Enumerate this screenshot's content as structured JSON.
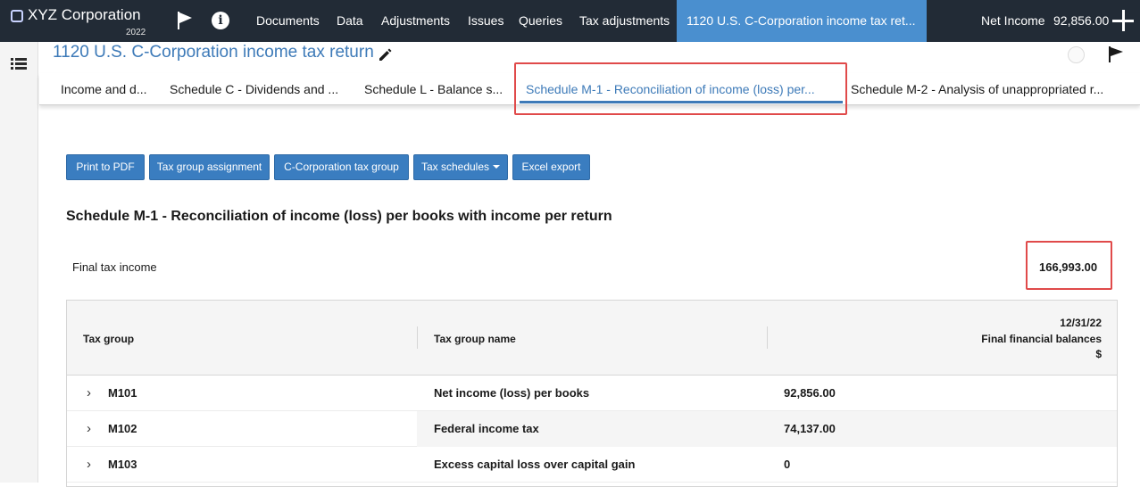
{
  "app": {
    "company": "XYZ Corporation",
    "year": "2022"
  },
  "topnav": {
    "items": [
      "Documents",
      "Data",
      "Adjustments",
      "Issues",
      "Queries",
      "Tax adjustments"
    ],
    "active": "1120 U.S. C-Corporation income tax ret...",
    "net_income_label": "Net Income",
    "net_income_value": "92,856.00"
  },
  "page": {
    "title": "1120 U.S. C-Corporation income tax return"
  },
  "tabs": [
    "Income and d...",
    "Schedule C - Dividends and ...",
    "Schedule L - Balance s...",
    "Schedule M-1 - Reconciliation of income (loss) per...",
    "Schedule M-2 - Analysis of unappropriated r..."
  ],
  "toolbar": {
    "print": "Print to PDF",
    "assignment": "Tax group assignment",
    "ccorp": "C-Corporation tax group",
    "schedules": "Tax schedules",
    "export": "Excel export"
  },
  "schedule": {
    "heading": "Schedule M-1 - Reconciliation of income (loss) per books with income per return",
    "final_label": "Final tax income",
    "final_value": "166,993.00"
  },
  "table": {
    "headers": {
      "group": "Tax group",
      "name": "Tax group name",
      "date": "12/31/22",
      "balances": "Final financial balances",
      "currency": "$"
    },
    "rows": [
      {
        "group": "M101",
        "name": "Net income (loss) per books",
        "value": "92,856.00"
      },
      {
        "group": "M102",
        "name": "Federal income tax",
        "value": "74,137.00"
      },
      {
        "group": "M103",
        "name": "Excess capital loss over capital gain",
        "value": "0"
      }
    ]
  },
  "colors": {
    "topbar": "#222b36",
    "accent": "#3d7ab8",
    "button": "#3a7dc0",
    "highlight": "#e04a4a"
  }
}
